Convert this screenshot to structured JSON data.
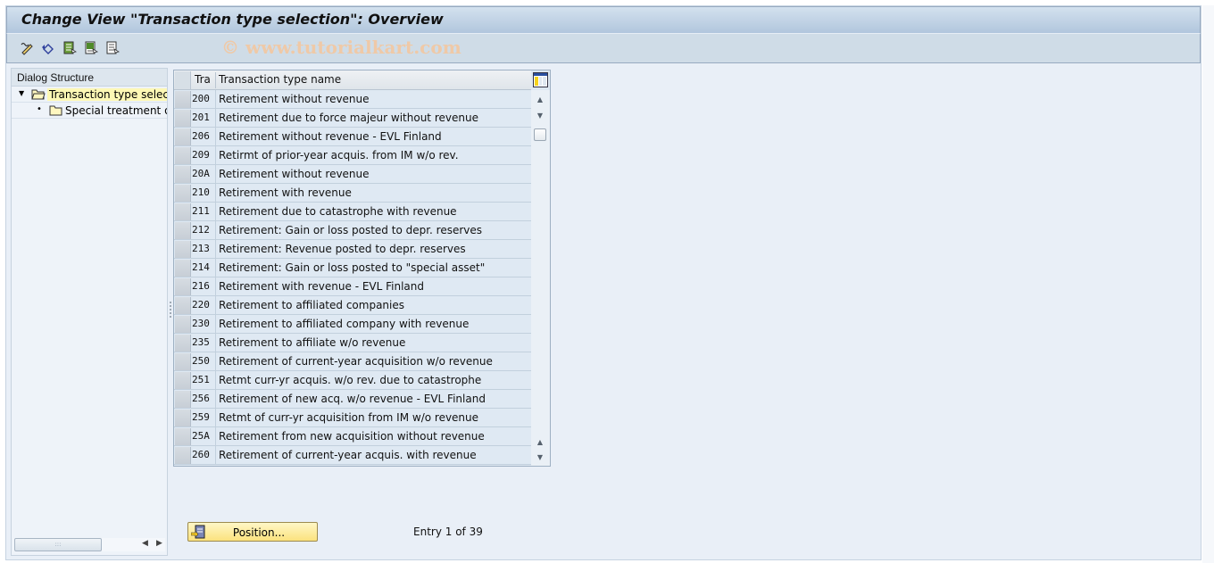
{
  "window": {
    "title": "Change View \"Transaction type selection\": Overview",
    "watermark": "© www.tutorialkart.com"
  },
  "toolbar": {
    "icons": [
      {
        "name": "display-change-icon"
      },
      {
        "name": "undo-icon"
      },
      {
        "name": "select-all-icon"
      },
      {
        "name": "select-block-icon"
      },
      {
        "name": "deselect-all-icon"
      }
    ]
  },
  "dialog_structure": {
    "header": "Dialog Structure",
    "items": [
      {
        "label": "Transaction type selection",
        "level": 0,
        "expanded": true,
        "selected": true
      },
      {
        "label": "Special treatment of",
        "level": 1,
        "expanded": false,
        "selected": false
      }
    ]
  },
  "table": {
    "columns": [
      "Tra",
      "Transaction type name"
    ],
    "rows": [
      {
        "code": "200",
        "name": "Retirement without revenue"
      },
      {
        "code": "201",
        "name": "Retirement due to force majeur without revenue"
      },
      {
        "code": "206",
        "name": "Retirement without revenue - EVL Finland"
      },
      {
        "code": "209",
        "name": "Retirmt of prior-year acquis. from IM w/o rev."
      },
      {
        "code": "20A",
        "name": "Retirement without revenue"
      },
      {
        "code": "210",
        "name": "Retirement with revenue"
      },
      {
        "code": "211",
        "name": "Retirement due to catastrophe with revenue"
      },
      {
        "code": "212",
        "name": "Retirement: Gain or loss posted to depr. reserves"
      },
      {
        "code": "213",
        "name": "Retirement: Revenue posted to depr. reserves"
      },
      {
        "code": "214",
        "name": "Retirement: Gain or loss posted to \"special asset\""
      },
      {
        "code": "216",
        "name": "Retirement with revenue - EVL Finland"
      },
      {
        "code": "220",
        "name": "Retirement to affiliated companies"
      },
      {
        "code": "230",
        "name": "Retirement to affiliated company with revenue"
      },
      {
        "code": "235",
        "name": "Retirement to affiliate w/o revenue"
      },
      {
        "code": "250",
        "name": "Retirement of current-year acquisition w/o revenue"
      },
      {
        "code": "251",
        "name": "Retmt curr-yr acquis. w/o rev. due to catastrophe"
      },
      {
        "code": "256",
        "name": "Retirement of new acq. w/o revenue - EVL Finland"
      },
      {
        "code": "259",
        "name": "Retmt of curr-yr acquisition from IM w/o revenue"
      },
      {
        "code": "25A",
        "name": "Retirement from new acquisition without revenue"
      },
      {
        "code": "260",
        "name": "Retirement of current-year acquis. with revenue"
      }
    ]
  },
  "footer": {
    "position_button": "Position...",
    "entry_info": "Entry 1 of 39"
  }
}
